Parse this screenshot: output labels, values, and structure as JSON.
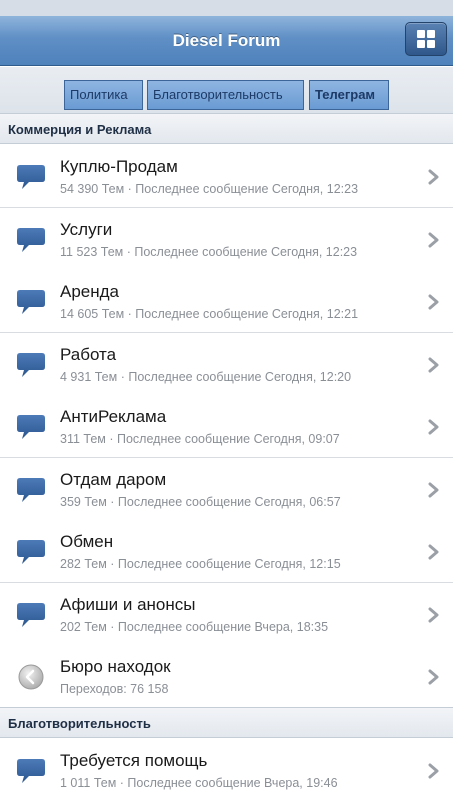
{
  "header": {
    "title": "Diesel Forum",
    "menu_icon": "grid-menu-icon"
  },
  "tabs": [
    {
      "label": "Политика"
    },
    {
      "label": "Благотворительность"
    },
    {
      "label": "Телеграм"
    }
  ],
  "sections": [
    {
      "title": "Коммерция и Реклама"
    },
    {
      "title": "Благотворительность"
    }
  ],
  "forums": [
    {
      "title": "Куплю-Продам",
      "meta": "54 390 Тем · Последнее сообщение Сегодня, 12:23",
      "icon": "speech-bubble-icon"
    },
    {
      "title": "Услуги",
      "meta": "11 523 Тем · Последнее сообщение Сегодня, 12:23",
      "icon": "speech-bubble-icon"
    },
    {
      "title": "Аренда",
      "meta": "14 605 Тем · Последнее сообщение Сегодня, 12:21",
      "icon": "speech-bubble-icon"
    },
    {
      "title": "Работа",
      "meta": "4 931 Тем · Последнее сообщение Сегодня, 12:20",
      "icon": "speech-bubble-icon"
    },
    {
      "title": "АнтиРеклама",
      "meta": "311 Тем · Последнее сообщение Сегодня, 09:07",
      "icon": "speech-bubble-icon"
    },
    {
      "title": "Отдам даром",
      "meta": "359 Тем · Последнее сообщение Сегодня, 06:57",
      "icon": "speech-bubble-icon"
    },
    {
      "title": "Обмен",
      "meta": "282 Тем · Последнее сообщение Сегодня, 12:15",
      "icon": "speech-bubble-icon"
    },
    {
      "title": "Афиши и анонсы",
      "meta": "202 Тем · Последнее сообщение Вчера, 18:35",
      "icon": "speech-bubble-icon"
    },
    {
      "title": "Бюро находок",
      "meta": "Переходов: 76 158",
      "icon": "redirect-arrow-icon"
    },
    {
      "title": "Требуется помощь",
      "meta": "1 011 Тем · Последнее сообщение Вчера, 19:46",
      "icon": "speech-bubble-icon"
    }
  ]
}
